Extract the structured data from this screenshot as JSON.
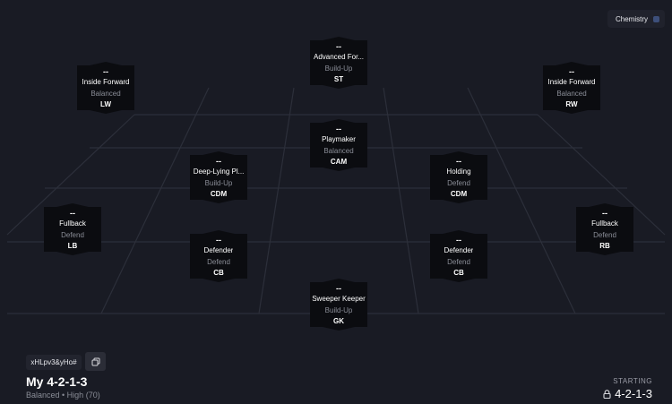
{
  "chemistry": {
    "label": "Chemistry",
    "enabled": false,
    "switch_color": "#3d4f7a"
  },
  "players": [
    {
      "rating": "--",
      "role": "Advanced For...",
      "focus": "Build-Up",
      "pos": "ST"
    },
    {
      "rating": "--",
      "role": "Inside Forward",
      "focus": "Balanced",
      "pos": "LW"
    },
    {
      "rating": "--",
      "role": "Inside Forward",
      "focus": "Balanced",
      "pos": "RW"
    },
    {
      "rating": "--",
      "role": "Playmaker",
      "focus": "Balanced",
      "pos": "CAM"
    },
    {
      "rating": "--",
      "role": "Deep-Lying Pl...",
      "focus": "Build-Up",
      "pos": "CDM"
    },
    {
      "rating": "--",
      "role": "Holding",
      "focus": "Defend",
      "pos": "CDM"
    },
    {
      "rating": "--",
      "role": "Fullback",
      "focus": "Defend",
      "pos": "LB"
    },
    {
      "rating": "--",
      "role": "Fullback",
      "focus": "Defend",
      "pos": "RB"
    },
    {
      "rating": "--",
      "role": "Defender",
      "focus": "Defend",
      "pos": "CB"
    },
    {
      "rating": "--",
      "role": "Defender",
      "focus": "Defend",
      "pos": "CB"
    },
    {
      "rating": "--",
      "role": "Sweeper Keeper",
      "focus": "Build-Up",
      "pos": "GK"
    }
  ],
  "share": {
    "code": "xHLpv3&yHo#"
  },
  "tactic": {
    "name": "My 4-2-1-3",
    "meta": "Balanced • High (70)"
  },
  "starting": {
    "label": "STARTING",
    "value": "4-2-1-3"
  },
  "colors": {
    "background": "#191b24",
    "card": "#0b0c10",
    "muted": "#8a8d97",
    "lines": "#2c2f3a"
  }
}
